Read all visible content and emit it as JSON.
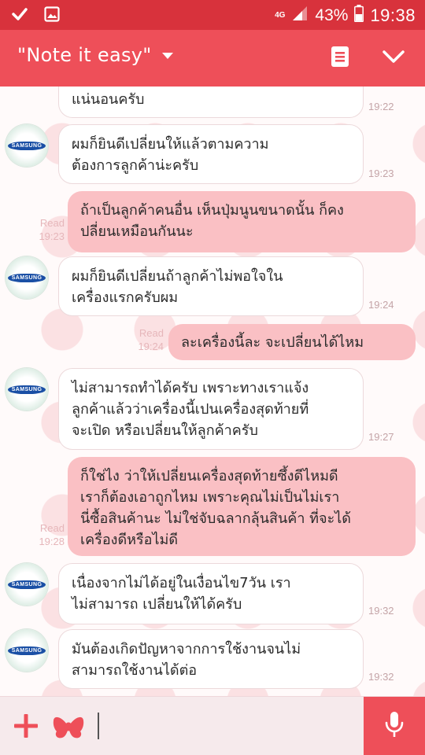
{
  "status_bar": {
    "network": "4G",
    "battery": "43%",
    "time": "19:38"
  },
  "header": {
    "title": "\"Note it easy\""
  },
  "input": {
    "placeholder": ""
  },
  "avatar": {
    "logo_text": "SAMSUNG"
  },
  "messages": [
    {
      "side": "in",
      "lines": [
        "แน่นอนครับ"
      ],
      "time": "19:22"
    },
    {
      "side": "in",
      "lines": [
        "ผมก็ยินดีเปลี่ยนให้แล้วตามความ",
        "ต้องการลูกค้าน่ะครับ"
      ],
      "time": "19:23"
    },
    {
      "side": "out",
      "lines": [
        "ถ้าเป็นลูกค้าคนอื่น เห็นปุ่มนูนขนาดนั้น ก็คง",
        "ปลี่ยนเหมือนกันนะ"
      ],
      "read": "Read",
      "time": "19:23"
    },
    {
      "side": "in",
      "lines": [
        "ผมก็ยินดีเปลี่ยนถ้าลูกค้าไม่พอใจใน",
        "เครื่องแรกครับผม"
      ],
      "time": "19:24"
    },
    {
      "side": "out",
      "lines": [
        "ละเครื่องนี้ละ จะเปลี่ยนได้ไหม"
      ],
      "read": "Read",
      "time": "19:24"
    },
    {
      "side": "in",
      "lines": [
        "ไม่สามารถทำได้ครับ เพราะทางเราแจ้ง",
        "ลูกค้าแล้วว่าเครื่องนี้เปนเครื่องสุดท้ายที่",
        "จะเปิด หรือเปลี่ยนให้ลูกค้าครับ"
      ],
      "time": "19:27"
    },
    {
      "side": "out",
      "lines": [
        "ก็ใช่ไง ว่าให้เปลี่ยนเครื่องสุดท้ายซึ้งดีไหมดี",
        "เราก็ต้องเอาถูกไหม เพราะคุณไม่เป็นไม่เรา",
        "นี่ซื้อสินค้านะ ไม่ใช่จับฉลากลุ้นสินค้า ที่จะได้",
        "เครื่องดีหรือไม่ดี"
      ],
      "read": "Read",
      "time": "19:28"
    },
    {
      "side": "in",
      "lines": [
        "เนื่องจากไม่ได้อยู่ในเงื่อนไข7วัน เรา",
        "ไม่สามารถ เปลี่ยนให้ได้ครับ"
      ],
      "time": "19:32"
    },
    {
      "side": "in",
      "lines": [
        "มันต้องเกิดปัญหาจากการใช้งานจนไม่",
        "สามารถใช้งานได้ต่อ"
      ],
      "time": "19:32"
    }
  ],
  "colors": {
    "status_bar": "#d8323c",
    "header": "#ee4f59",
    "outgoing_bubble": "#fac0c4",
    "incoming_bubble": "#ffffff",
    "accent": "#ee4f59"
  },
  "icons": {
    "status_left": [
      "check-icon",
      "gallery-icon"
    ],
    "status_right": [
      "signal-icon",
      "battery-icon"
    ],
    "header": [
      "chevron-down-icon",
      "memo-icon",
      "collapse-icon"
    ],
    "input": [
      "plus-icon",
      "bow-sticker-icon",
      "mic-icon"
    ]
  }
}
